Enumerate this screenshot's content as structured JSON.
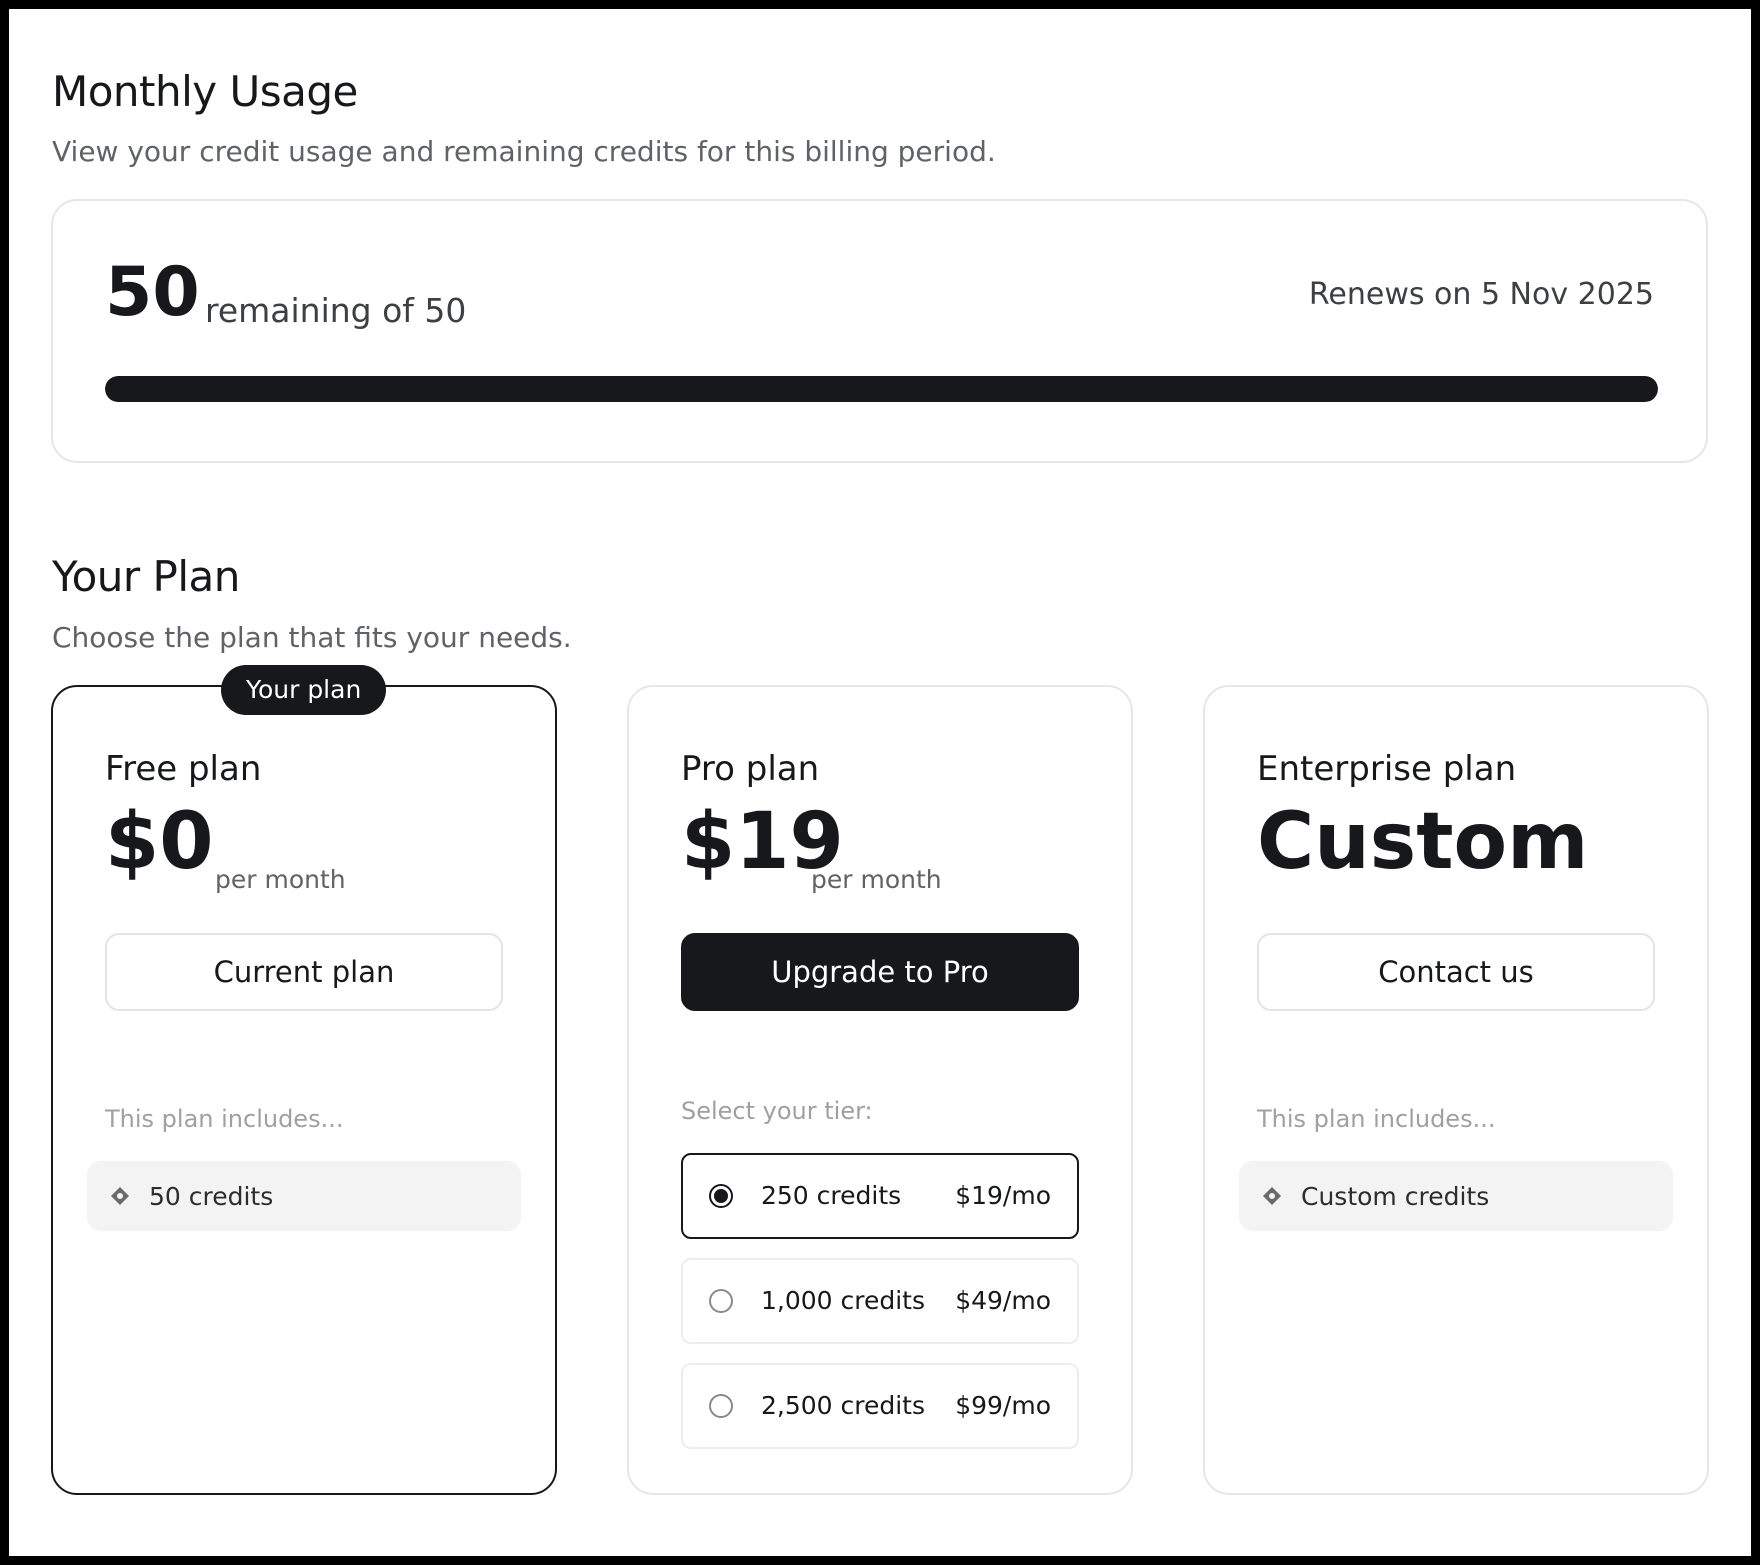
{
  "usage": {
    "title": "Monthly Usage",
    "subtitle": "View your credit usage and remaining credits for this billing period.",
    "remaining": "50",
    "remaining_label": "remaining of 50",
    "renews": "Renews on 5 Nov 2025",
    "progress_fraction": 1.0
  },
  "plan_section": {
    "title": "Your Plan",
    "subtitle": "Choose the plan that fits your needs."
  },
  "plans": {
    "free": {
      "badge": "Your plan",
      "name": "Free plan",
      "price": "$0",
      "period": "per month",
      "button": "Current plan",
      "includes_label": "This plan includes...",
      "feature": "50 credits",
      "feature_icon": "diamond-icon"
    },
    "pro": {
      "name": "Pro plan",
      "price": "$19",
      "period": "per month",
      "button": "Upgrade to Pro",
      "tier_label": "Select your tier:",
      "tiers": [
        {
          "credits": "250 credits",
          "price": "$19/mo",
          "selected": true
        },
        {
          "credits": "1,000 credits",
          "price": "$49/mo",
          "selected": false
        },
        {
          "credits": "2,500 credits",
          "price": "$99/mo",
          "selected": false
        }
      ]
    },
    "enterprise": {
      "name": "Enterprise plan",
      "price": "Custom",
      "button": "Contact us",
      "includes_label": "This plan includes...",
      "feature": "Custom credits",
      "feature_icon": "diamond-icon"
    }
  },
  "colors": {
    "primary": "#16181b",
    "muted_text": "#5f6368",
    "border": "#e6e6e6",
    "pill_bg": "#f3f3f3"
  }
}
